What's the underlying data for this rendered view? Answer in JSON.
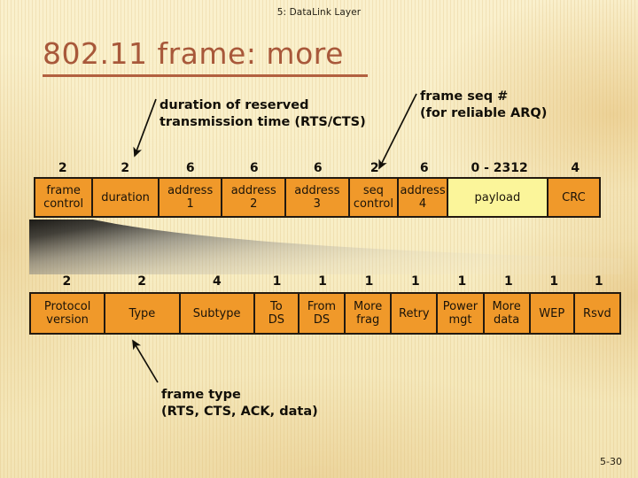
{
  "header": {
    "text": "5: DataLink Layer"
  },
  "title": {
    "text": "802.11 frame: more"
  },
  "callouts": {
    "duration": {
      "line1": "duration of reserved",
      "line2": "transmission time (RTS/CTS)"
    },
    "seq": {
      "line1": "frame seq #",
      "line2": "(for reliable ARQ)"
    },
    "frame_type": {
      "line1": "frame type",
      "line2": "(RTS, CTS, ACK, data)"
    }
  },
  "frame_row": {
    "lengths": [
      "2",
      "2",
      "6",
      "6",
      "6",
      "2",
      "6",
      "0 - 2312",
      "4"
    ],
    "cells": [
      {
        "line1": "frame",
        "line2": "control",
        "highlight": false
      },
      {
        "line1": "duration",
        "line2": "",
        "highlight": false
      },
      {
        "line1": "address",
        "line2": "1",
        "highlight": false
      },
      {
        "line1": "address",
        "line2": "2",
        "highlight": false
      },
      {
        "line1": "address",
        "line2": "3",
        "highlight": false
      },
      {
        "line1": "seq",
        "line2": "control",
        "highlight": false
      },
      {
        "line1": "address",
        "line2": "4",
        "highlight": false
      },
      {
        "line1": "payload",
        "line2": "",
        "highlight": true
      },
      {
        "line1": "CRC",
        "line2": "",
        "highlight": false
      }
    ]
  },
  "frame_control_row": {
    "lengths": [
      "2",
      "2",
      "4",
      "1",
      "1",
      "1",
      "1",
      "1",
      "1",
      "1",
      "1"
    ],
    "cells": [
      {
        "line1": "Protocol",
        "line2": "version"
      },
      {
        "line1": "Type",
        "line2": ""
      },
      {
        "line1": "Subtype",
        "line2": ""
      },
      {
        "line1": "To",
        "line2": "DS"
      },
      {
        "line1": "From",
        "line2": "DS"
      },
      {
        "line1": "More",
        "line2": "frag"
      },
      {
        "line1": "Retry",
        "line2": ""
      },
      {
        "line1": "Power",
        "line2": "mgt"
      },
      {
        "line1": "More",
        "line2": "data"
      },
      {
        "line1": "WEP",
        "line2": ""
      },
      {
        "line1": "Rsvd",
        "line2": ""
      }
    ]
  },
  "page_number": {
    "text": "5-30"
  },
  "colors": {
    "background": "#f7ecc2",
    "title": "#a8583a",
    "cell_fill": "#f0992a",
    "payload_fill": "#fbf59a",
    "border": "#231a10",
    "text": "#1a1309"
  }
}
